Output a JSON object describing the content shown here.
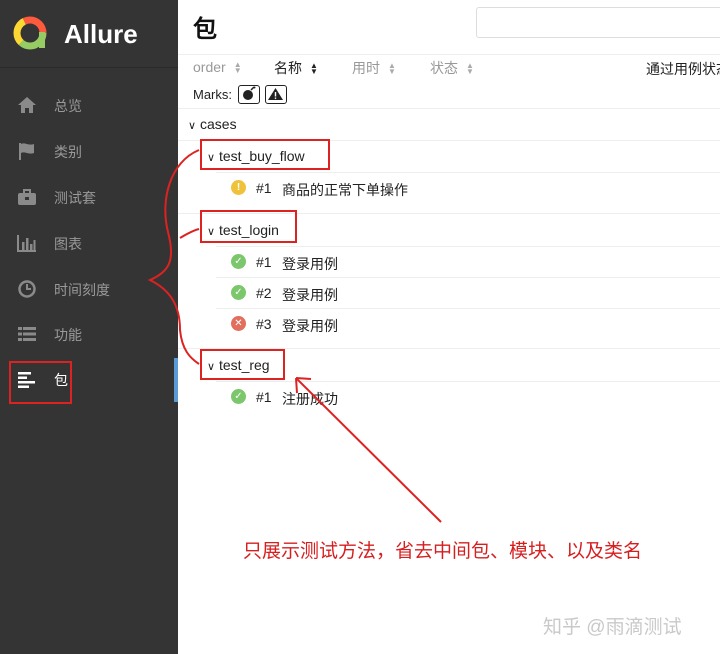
{
  "brand": {
    "name": "Allure",
    "colors": {
      "green": "#97cc64",
      "yellow": "#fdd835",
      "red": "#fd5a3e"
    }
  },
  "sidebar": {
    "items": [
      {
        "label": "总览",
        "icon": "home-icon"
      },
      {
        "label": "类别",
        "icon": "flag-icon"
      },
      {
        "label": "测试套",
        "icon": "briefcase-icon"
      },
      {
        "label": "图表",
        "icon": "bar-chart-icon"
      },
      {
        "label": "时间刻度",
        "icon": "clock-icon"
      },
      {
        "label": "功能",
        "icon": "list-icon"
      },
      {
        "label": "包",
        "icon": "align-left-icon"
      }
    ],
    "active_index": 6
  },
  "page": {
    "title": "包"
  },
  "sort": {
    "columns": [
      {
        "label": "order"
      },
      {
        "label": "名称"
      },
      {
        "label": "用时"
      },
      {
        "label": "状态"
      }
    ],
    "active": "名称",
    "passed_rate_label": "通过用例状态"
  },
  "marks": {
    "label": "Marks:",
    "buttons": [
      "flaky-mark-icon",
      "warning-mark-icon"
    ]
  },
  "tree": {
    "root": "cases",
    "groups": [
      {
        "name": "test_buy_flow",
        "cases": [
          {
            "num": "#1",
            "name": "商品的正常下单操作",
            "status": "broken"
          }
        ]
      },
      {
        "name": "test_login",
        "cases": [
          {
            "num": "#1",
            "name": "登录用例",
            "status": "passed"
          },
          {
            "num": "#2",
            "name": "登录用例",
            "status": "passed"
          },
          {
            "num": "#3",
            "name": "登录用例",
            "status": "failed"
          }
        ]
      },
      {
        "name": "test_reg",
        "cases": [
          {
            "num": "#1",
            "name": "注册成功",
            "status": "passed"
          }
        ]
      }
    ]
  },
  "annotation": {
    "text": "只展示测试方法，省去中间包、模块、以及类名",
    "color": "#d61f1f"
  },
  "watermark": {
    "text": "知乎 @雨滴测试"
  }
}
